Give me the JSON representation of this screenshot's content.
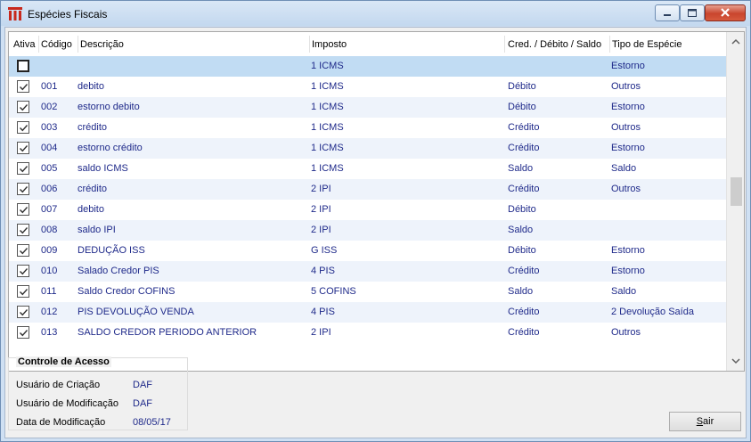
{
  "window": {
    "title": "Espécies Fiscais",
    "icon": "app-columns-icon",
    "controls": [
      "minimize-icon",
      "maximize-icon",
      "close-icon"
    ]
  },
  "table": {
    "columns": [
      "Ativa",
      "Código",
      "Descrição",
      "Imposto",
      "Cred. / Débito / Saldo",
      "Tipo de Espécie"
    ],
    "rows": [
      {
        "ativa": false,
        "codigo": "",
        "descricao": "",
        "imposto": "1 ICMS",
        "cred": "",
        "tipo": "Estorno"
      },
      {
        "ativa": true,
        "codigo": "001",
        "descricao": "debito",
        "imposto": "1 ICMS",
        "cred": "Débito",
        "tipo": "Outros"
      },
      {
        "ativa": true,
        "codigo": "002",
        "descricao": "estorno debito",
        "imposto": "1 ICMS",
        "cred": "Débito",
        "tipo": "Estorno"
      },
      {
        "ativa": true,
        "codigo": "003",
        "descricao": "crédito",
        "imposto": "1 ICMS",
        "cred": "Crédito",
        "tipo": "Outros"
      },
      {
        "ativa": true,
        "codigo": "004",
        "descricao": "estorno crédito",
        "imposto": "1 ICMS",
        "cred": "Crédito",
        "tipo": "Estorno"
      },
      {
        "ativa": true,
        "codigo": "005",
        "descricao": "saldo ICMS",
        "imposto": "1 ICMS",
        "cred": "Saldo",
        "tipo": "Saldo"
      },
      {
        "ativa": true,
        "codigo": "006",
        "descricao": "crédito",
        "imposto": "2 IPI",
        "cred": "Crédito",
        "tipo": "Outros"
      },
      {
        "ativa": true,
        "codigo": "007",
        "descricao": "debito",
        "imposto": "2 IPI",
        "cred": "Débito",
        "tipo": ""
      },
      {
        "ativa": true,
        "codigo": "008",
        "descricao": "saldo IPI",
        "imposto": "2 IPI",
        "cred": "Saldo",
        "tipo": ""
      },
      {
        "ativa": true,
        "codigo": "009",
        "descricao": "DEDUÇÃO ISS",
        "imposto": "G ISS",
        "cred": "Débito",
        "tipo": "Estorno"
      },
      {
        "ativa": true,
        "codigo": "010",
        "descricao": "Salado Credor PIS",
        "imposto": "4 PIS",
        "cred": "Crédito",
        "tipo": "Estorno"
      },
      {
        "ativa": true,
        "codigo": "011",
        "descricao": "Saldo Credor COFINS",
        "imposto": "5 COFINS",
        "cred": "Saldo",
        "tipo": "Saldo"
      },
      {
        "ativa": true,
        "codigo": "012",
        "descricao": "PIS DEVOLUÇÃO VENDA",
        "imposto": "4 PIS",
        "cred": "Crédito",
        "tipo": "2 Devolução Saída"
      },
      {
        "ativa": true,
        "codigo": "013",
        "descricao": "SALDO CREDOR PERIODO ANTERIOR",
        "imposto": "2 IPI",
        "cred": "Crédito",
        "tipo": "Outros"
      }
    ]
  },
  "access_control": {
    "title": "Controle de Acesso",
    "created_by_label": "Usuário de Criação",
    "created_by": "DAF",
    "modified_by_label": "Usuário de Modificação",
    "modified_by": "DAF",
    "modified_date_label": "Data de Modificação",
    "modified_date": "08/05/17"
  },
  "buttons": {
    "sair": "Sair"
  },
  "colors": {
    "selected_row": "#c1dcf3",
    "alt_row": "#eef3fb",
    "cell_text": "#1f2a8a",
    "icon_red": "#c8281c"
  }
}
